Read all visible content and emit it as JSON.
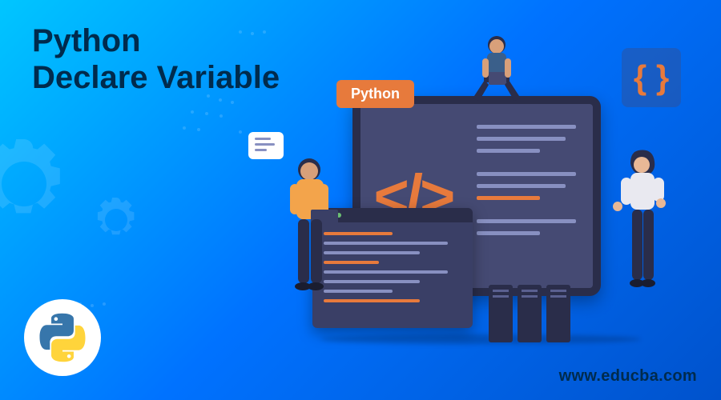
{
  "title_line1": "Python",
  "title_line2": "Declare Variable",
  "badge_text": "Python",
  "code_symbol": "</>",
  "braces_symbol": "{ }",
  "website_url": "www.educba.com"
}
